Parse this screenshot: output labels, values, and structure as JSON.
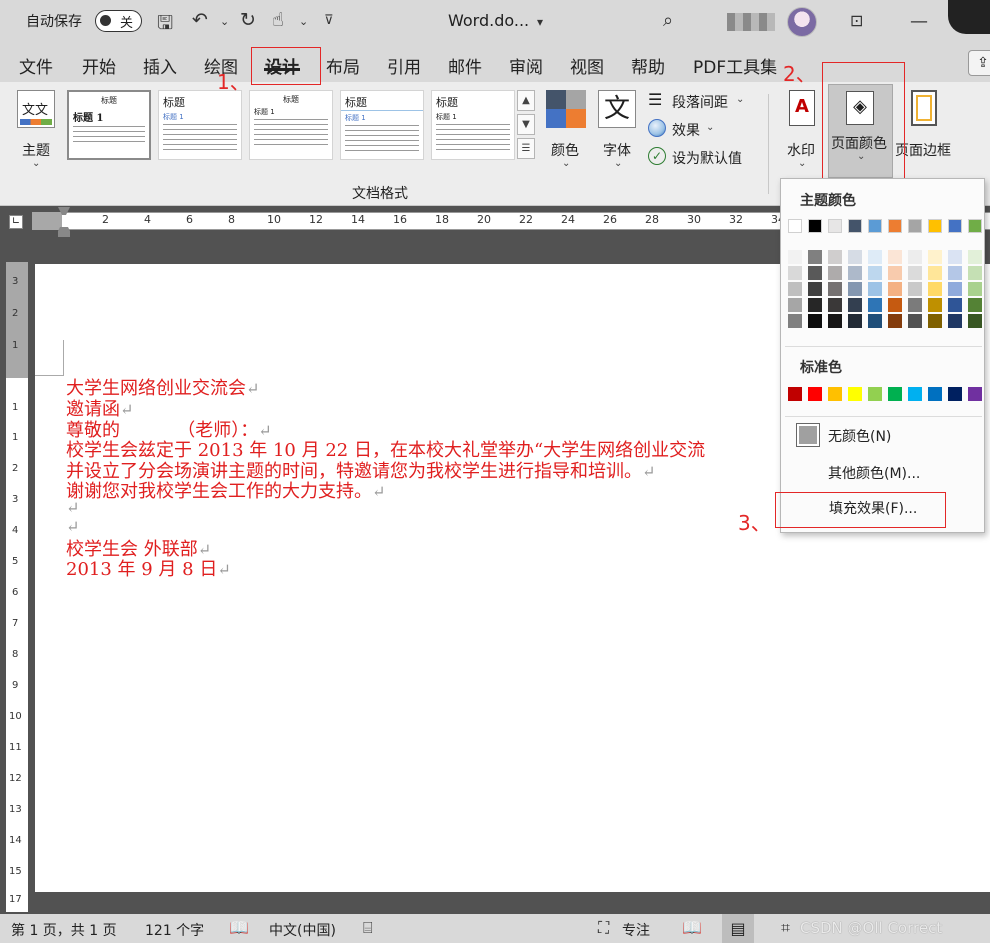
{
  "titlebar": {
    "autosave_label": "自动保存",
    "autosave_state": "关",
    "doc_title": "Word.do...",
    "chevron": "⌄"
  },
  "tabs": [
    {
      "label": "文件"
    },
    {
      "label": "开始"
    },
    {
      "label": "插入"
    },
    {
      "label": "绘图"
    },
    {
      "label": "设计"
    },
    {
      "label": "布局"
    },
    {
      "label": "引用"
    },
    {
      "label": "邮件"
    },
    {
      "label": "审阅"
    },
    {
      "label": "视图"
    },
    {
      "label": "帮助"
    },
    {
      "label": "PDF工具集"
    }
  ],
  "annotations": {
    "step1": "1、",
    "step2": "2、",
    "step3": "3、"
  },
  "ribbon": {
    "theme_label": "主题",
    "theme_glyph": "文文",
    "styles": [
      {
        "title": "标题",
        "heading": "标题 1"
      },
      {
        "title": "标题",
        "heading": "标题 1"
      },
      {
        "title": "标题",
        "heading": "标题 1"
      },
      {
        "title": "标题",
        "heading": "标题 1"
      },
      {
        "title": "标题",
        "heading": "标题 1"
      }
    ],
    "colors_label": "颜色",
    "fonts_label": "字体",
    "fonts_glyph": "文",
    "paragraph_spacing": "段落间距",
    "effects": "效果",
    "set_default": "设为默认值",
    "group_label": "文档格式",
    "watermark_label": "水印",
    "page_color_label": "页面颜色",
    "page_border_label": "页面边框"
  },
  "ruler": {
    "h_numbers": [
      "2",
      "4",
      "6",
      "8",
      "10",
      "12",
      "14",
      "16",
      "18",
      "20",
      "22",
      "24",
      "26",
      "28",
      "30",
      "32",
      "34"
    ],
    "v_numbers": [
      "3",
      "2",
      "1",
      "1",
      "1",
      "2",
      "3",
      "4",
      "5",
      "6",
      "7",
      "8",
      "9",
      "10",
      "11",
      "12",
      "13",
      "14",
      "15",
      "16",
      "17"
    ]
  },
  "document": {
    "pilcrow": "↵",
    "lines": [
      "大学生网络创业交流会",
      "邀请函",
      "尊敬的          （老师）：",
      "校学生会兹定于 2013 年 10 月 22 日，在本校大礼堂举办“大学生网络创业交流",
      "并设立了分会场演讲主题的时间，特邀请您为我校学生进行指导和培训。",
      "谢谢您对我校学生会工作的大力支持。",
      "",
      "",
      "校学生会 外联部",
      "2013 年 9 月 8 日"
    ]
  },
  "page_color_menu": {
    "theme_colors_label": "主题颜色",
    "theme_colors": [
      "#ffffff",
      "#000000",
      "#e7e6e6",
      "#44546a",
      "#5b9bd5",
      "#ed7d31",
      "#a5a5a5",
      "#ffc000",
      "#4472c4",
      "#70ad47"
    ],
    "theme_shades": [
      [
        "#f2f2f2",
        "#d9d9d9",
        "#bfbfbf",
        "#a6a6a6",
        "#808080"
      ],
      [
        "#808080",
        "#595959",
        "#404040",
        "#262626",
        "#0d0d0d"
      ],
      [
        "#d0cece",
        "#aeabab",
        "#757171",
        "#3a3838",
        "#171616"
      ],
      [
        "#d6dce5",
        "#adb9ca",
        "#8497b0",
        "#333f50",
        "#222a35"
      ],
      [
        "#deebf7",
        "#bdd7ee",
        "#9dc3e6",
        "#2e75b6",
        "#1f4e79"
      ],
      [
        "#fbe5d6",
        "#f8cbad",
        "#f4b183",
        "#c55a11",
        "#843c0c"
      ],
      [
        "#ededed",
        "#dbdbdb",
        "#c9c9c9",
        "#7b7b7b",
        "#525252"
      ],
      [
        "#fff2cc",
        "#ffe699",
        "#ffd966",
        "#bf9000",
        "#7f6000"
      ],
      [
        "#dae3f3",
        "#b4c7e7",
        "#8faadc",
        "#2f5597",
        "#203864"
      ],
      [
        "#e2f0d9",
        "#c5e0b4",
        "#a9d18e",
        "#548235",
        "#385723"
      ]
    ],
    "standard_colors_label": "标准色",
    "standard_colors": [
      "#c00000",
      "#ff0000",
      "#ffc000",
      "#ffff00",
      "#92d050",
      "#00b050",
      "#00b0f0",
      "#0070c0",
      "#002060",
      "#7030a0"
    ],
    "no_color": "无颜色(N)",
    "more_colors": "其他颜色(M)...",
    "fill_effects": "填充效果(F)..."
  },
  "status": {
    "page": "第 1 页，共 1 页",
    "words": "121 个字",
    "language": "中文(中国)",
    "focus": "专注",
    "watermark": "CSDN @Oll Correct"
  }
}
